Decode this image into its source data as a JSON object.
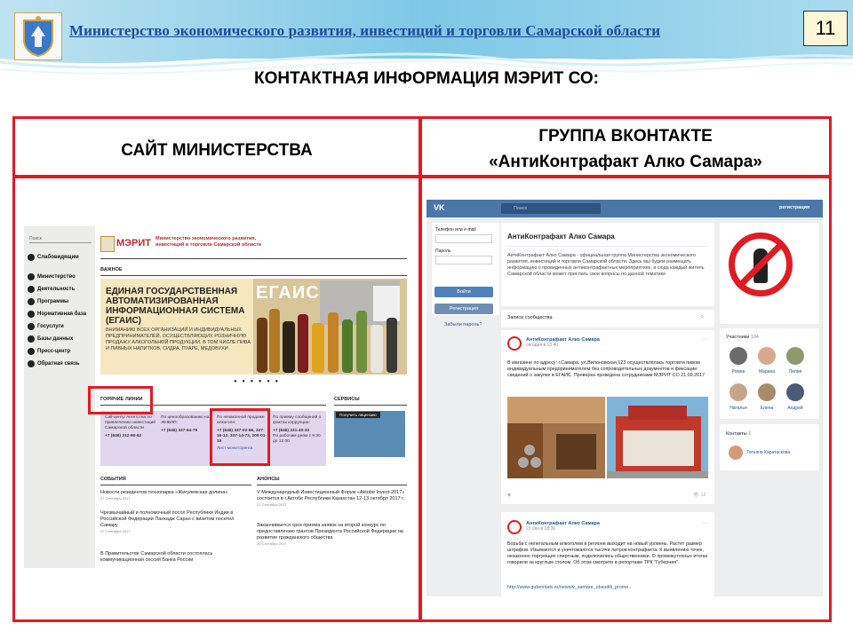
{
  "header": {
    "ministry": "Министерство экономического развития, инвестиций и торговли Самарской области",
    "page_number": "11",
    "title": "КОНТАКТНАЯ ИНФОРМАЦИЯ МЭРИТ СО:"
  },
  "columns": {
    "left_title": "САЙТ МИНИСТЕРСТВА",
    "right_title_line1": "ГРУППА ВКОНТАКТЕ",
    "right_title_line2": "«АнтиКонтрафакт Алко Самара»"
  },
  "site": {
    "search": "Поиск",
    "menu": [
      "Слабовидящим",
      "Министерство",
      "Деятельность",
      "Программы",
      "Нормативная база",
      "Госуслуги",
      "Базы данных",
      "Пресс-центр",
      "Обратная связь"
    ],
    "logo": "МЭРИТ",
    "ministry": "Министерство экономического развития, инвестиций и торговли Самарской области",
    "important": "ВАЖНОЕ",
    "banner_title": "ЕДИНАЯ ГОСУДАРСТВЕННАЯ АВТОМАТИЗИРОВАННАЯ ИНФОРМАЦИОННАЯ СИСТЕМА (ЕГАИС)",
    "banner_sub": "ВНИМАНИЮ ВСЕХ ОРГАНИЗАЦИЙ И ИНДИВИДУАЛЬНЫХ ПРЕДПРИНИМАТЕЛЕЙ, ОСУЩЕСТВЛЯЮЩИХ РОЗНИЧНУЮ ПРОДАЖУ АЛКОГОЛЬНОЙ ПРОДУКЦИИ, В ТОМ ЧИСЛЕ ПИВА И ПИВНЫХ НАПИТКОВ, СИДРА, ПУАРЕ, МЕДОВУХИ",
    "banner_logo": "ЕГАИС",
    "hot_lines": "ГОРЯЧИЕ ЛИНИИ",
    "services": "СЕРВИСЫ",
    "services_btn": "Получить лицензию",
    "lines": [
      {
        "text": "Call-центр Агентства по привлечению инвестиций Самарской области",
        "phone": "+7 (846) 212-96-62"
      },
      {
        "text": "По ценообразованию на ЖНВЛП:",
        "phone": "+7 (846) 337-54-79"
      },
      {
        "text": "По незаконной продаже алкоголя:",
        "phone": "+7 (846) 337-02-66, 337-16-12, 337-14-73, 200-01-15",
        "link": "Лист мониторинга"
      },
      {
        "text": "По приему сообщений о фактах коррупции:",
        "phone": "+7 (846) 221-40-33",
        "extra": "По рабочим дням с 9:30 до 12:00"
      }
    ],
    "events": "СОБЫТИЯ",
    "announcements": "АНОНСЫ",
    "events_list": [
      {
        "title": "Новости резидентов технопарка «Жигулевская долина»",
        "date": "27 Сентября 2017"
      },
      {
        "title": "Чрезвычайный и полномочный посол Республики Индии в Российской Федерации Панкадж Саран с визитом посетил Самару",
        "date": "27 Сентября 2017"
      },
      {
        "title": "В Правительстве Самарской области состоялась коммуникационная сессия Банка России",
        "date": ""
      }
    ],
    "announcements_list": [
      {
        "title": "V Международный Инвестиционный Форум «Aktobe Invest-2017» состоится в г.Актобе Республики Казахстан 12-13 октября 2017 г.",
        "date": "21 Сентября 2017"
      },
      {
        "title": "Заканчивается срок приема заявок на второй конкурс по предоставлению грантов Президента Российской Федерации на развитие гражданского общества",
        "date": "20 Сентября 2017"
      }
    ]
  },
  "vk": {
    "search": "Поиск",
    "register": "регистрация",
    "login_label": "Телефон или e-mail",
    "password_label": "Пароль",
    "login_btn": "Войти",
    "register_btn": "Регистрация",
    "forgot": "Забыли пароль?",
    "group_name": "АнтиКонтрафакт Алко Самара",
    "group_desc": "АнтиКонтрафакт Алко Самара - официальная группа Министерства экономического развития, инвестиций и торговли Самарской области. Здесь мы будем размещать информацию о проведенных антиконтрафактных мероприятиях, и сюда каждый житель Самарской области может прислать свои вопросы по данной тематике",
    "posts_tab": "Записи сообщества",
    "post1": {
      "author": "АнтиКонтрафакт Алко Самара",
      "date": "сегодня в 13:40",
      "text": "В магазине по адресу: г.Самара, ул.Вилоновская,123 осуществлялась торговля пивом индивидуальным предпринимателем без сопроводительных документов и фиксации сведений о закупке в ЕГАИС. Проверка проведена сотрудниками МЭРИТ СО 21.09.2017",
      "views": "12"
    },
    "post2": {
      "author": "АнтиКонтрафакт Алко Самара",
      "date": "22 сен в 18:39",
      "text": "Борьба с нелегальным алкоголем в регионе выходит на новый уровень. Растет размер штрафов. Изымаются и уничтожаются тысячи литров контрафакта. К выявлению точек, незаконно торгующих спиртным, подключились общественники. О промежуточных итогах говорили за круглым столом. Об этом смотрите в репортаже ТРК \"Губерния\".",
      "link": "http://www.guberniatv.ru/news/v_samare_obsudili_prome.."
    },
    "members_label": "Участники",
    "members_count": "104",
    "members": [
      "Роман",
      "Марина",
      "Лилия",
      "Наталья",
      "Елена",
      "Андрей"
    ],
    "contacts_label": "Контакты",
    "contacts_count": "1",
    "contact_name": "Татьяна Каратаскова"
  }
}
